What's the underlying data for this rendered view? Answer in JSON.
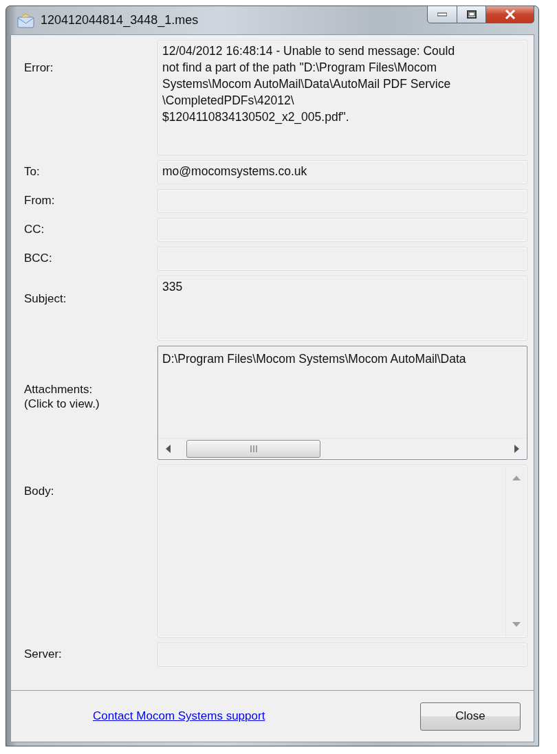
{
  "window": {
    "title": "120412044814_3448_1.mes"
  },
  "fields": [
    {
      "kind": "memo",
      "label": [
        "Error:"
      ],
      "lines": [
        "12/04/2012 16:48:14 - Unable to send message: Could",
        "not find a part of the path \"D:\\Program Files\\Mocom",
        "Systems\\Mocom AutoMail\\Data\\AutoMail PDF Service",
        "\\CompletedPDFs\\42012\\",
        "$1204110834130502_x2_005.pdf\"."
      ]
    },
    {
      "kind": "text",
      "label": [
        "To:"
      ],
      "lines": [
        "mo@mocomsystems.co.uk"
      ]
    },
    {
      "kind": "text",
      "label": [
        "From:"
      ]
    },
    {
      "kind": "text",
      "label": [
        "CC:"
      ]
    },
    {
      "kind": "text",
      "label": [
        "BCC:"
      ]
    },
    {
      "kind": "subject",
      "label": [
        "Subject:"
      ],
      "lines": [
        "335"
      ]
    },
    {
      "kind": "list",
      "label": [
        "Attachments:",
        "(Click to view.)"
      ],
      "lines": [
        "D:\\Program Files\\Mocom Systems\\Mocom AutoMail\\Data"
      ]
    },
    {
      "kind": "body",
      "label": [
        "Body:"
      ]
    },
    {
      "kind": "text",
      "label": [
        "Server:"
      ]
    }
  ],
  "footer": {
    "link": "Contact Mocom Systems support",
    "button": "Close"
  }
}
